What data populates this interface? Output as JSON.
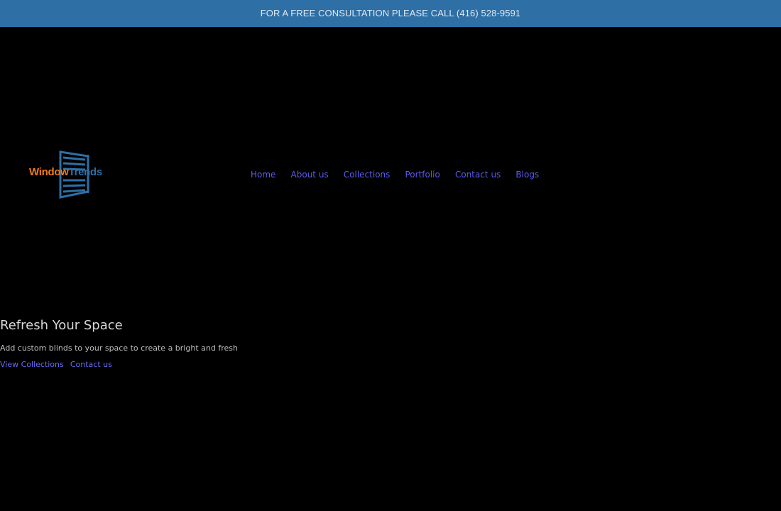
{
  "topbar": {
    "text": "FOR A FREE CONSULTATION PLEASE CALL (416) 528-9591"
  },
  "logo": {
    "word1": "Window",
    "word2": "Trends",
    "icon": "window-blinds-icon",
    "colors": {
      "orange": "#f07b1d",
      "blue": "#2e6fa6"
    }
  },
  "nav": {
    "items": [
      {
        "label": "Home"
      },
      {
        "label": "About us"
      },
      {
        "label": "Collections"
      },
      {
        "label": "Portfolio"
      },
      {
        "label": "Contact us"
      },
      {
        "label": "Blogs"
      }
    ]
  },
  "hero": {
    "title": "Refresh Your Space",
    "text": "Add custom blinds to your space to create a bright and fresh",
    "links": [
      {
        "label": "View Collections"
      },
      {
        "label": "Contact us"
      }
    ]
  },
  "colors": {
    "topbar_bg": "#2e6fa6",
    "page_bg": "#000000",
    "link": "#5b5bf0"
  }
}
